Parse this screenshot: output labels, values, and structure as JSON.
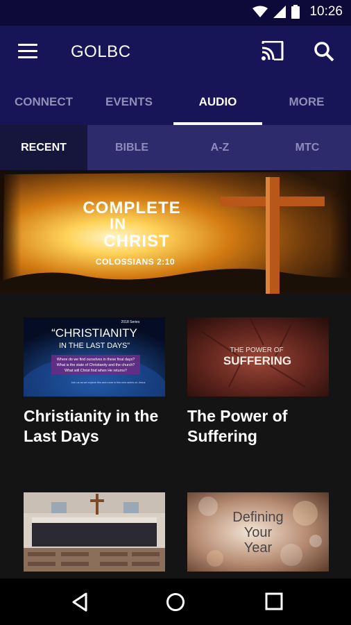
{
  "status": {
    "time": "10:26"
  },
  "app": {
    "title": "GOLBC"
  },
  "tabs": [
    {
      "label": "CONNECT"
    },
    {
      "label": "EVENTS"
    },
    {
      "label": "AUDIO"
    },
    {
      "label": "MORE"
    }
  ],
  "subtabs": [
    {
      "label": "RECENT"
    },
    {
      "label": "BIBLE"
    },
    {
      "label": "A-Z"
    },
    {
      "label": "MTC"
    }
  ],
  "banner": {
    "line1": "COMPLETE",
    "line2": "IN",
    "line3": "CHRIST",
    "reference": "COLOSSIANS 2:10"
  },
  "cards": [
    {
      "title": "Christianity in the Last Days",
      "thumb_year": "2018 Series",
      "thumb_heading1": "“CHRISTIANITY",
      "thumb_heading2": "IN THE LAST DAYS”",
      "thumb_q1": "Where do we find ourselves in these final days?",
      "thumb_q2": "What is the state of Christianity and the church?",
      "thumb_q3": "What will Christ find when He returns?",
      "thumb_footer": "Join us as we explore this and more in this new series on Jesus"
    },
    {
      "title": "The Power of Suffering",
      "thumb_line1": "THE POWER OF",
      "thumb_line2": "SUFFERING"
    },
    {
      "title": ""
    },
    {
      "title": "",
      "thumb_line1": "Defining",
      "thumb_line2": "Your",
      "thumb_line3": "Year"
    }
  ],
  "icons": {
    "menu": "hamburger-menu-icon",
    "cast": "cast-icon",
    "search": "search-icon",
    "back": "back-triangle-icon",
    "home": "home-circle-icon",
    "recents": "recents-square-icon"
  },
  "colors": {
    "appbar": "#171457",
    "statusbar": "#0d0a3a",
    "subtabs": "#2d2b6c",
    "subtab_active": "#16153b",
    "background": "#141414"
  }
}
